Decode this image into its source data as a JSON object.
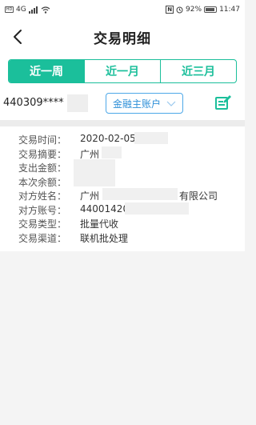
{
  "status_bar": {
    "network": "4G",
    "nfc": "N",
    "battery": "92%",
    "battery_level": 0.92,
    "time": "11:47"
  },
  "header": {
    "title": "交易明细"
  },
  "tabs": [
    {
      "label": "近一周",
      "active": true
    },
    {
      "label": "近一月",
      "active": false
    },
    {
      "label": "近三月",
      "active": false
    }
  ],
  "account": {
    "number": "440309****",
    "type_selected": "金融主账户"
  },
  "transaction": {
    "time_label": "交易时间：",
    "time_value": "2020-02-05",
    "summary_label": "交易摘要：",
    "summary_value": "广州",
    "expense_label": "支出金额：",
    "balance_label": "本次余额：",
    "counterparty_name_label": "对方姓名：",
    "counterparty_name_value": "广州",
    "counterparty_name_suffix": "有限公司",
    "counterparty_account_label": "对方账号：",
    "counterparty_account_value": "44001420",
    "type_label": "交易类型：",
    "type_value": "批量代收",
    "channel_label": "交易渠道：",
    "channel_value": "联机批处理"
  },
  "colors": {
    "accent": "#1bbf9b",
    "select_border": "#4da8e8",
    "select_text": "#2d8fd8"
  }
}
